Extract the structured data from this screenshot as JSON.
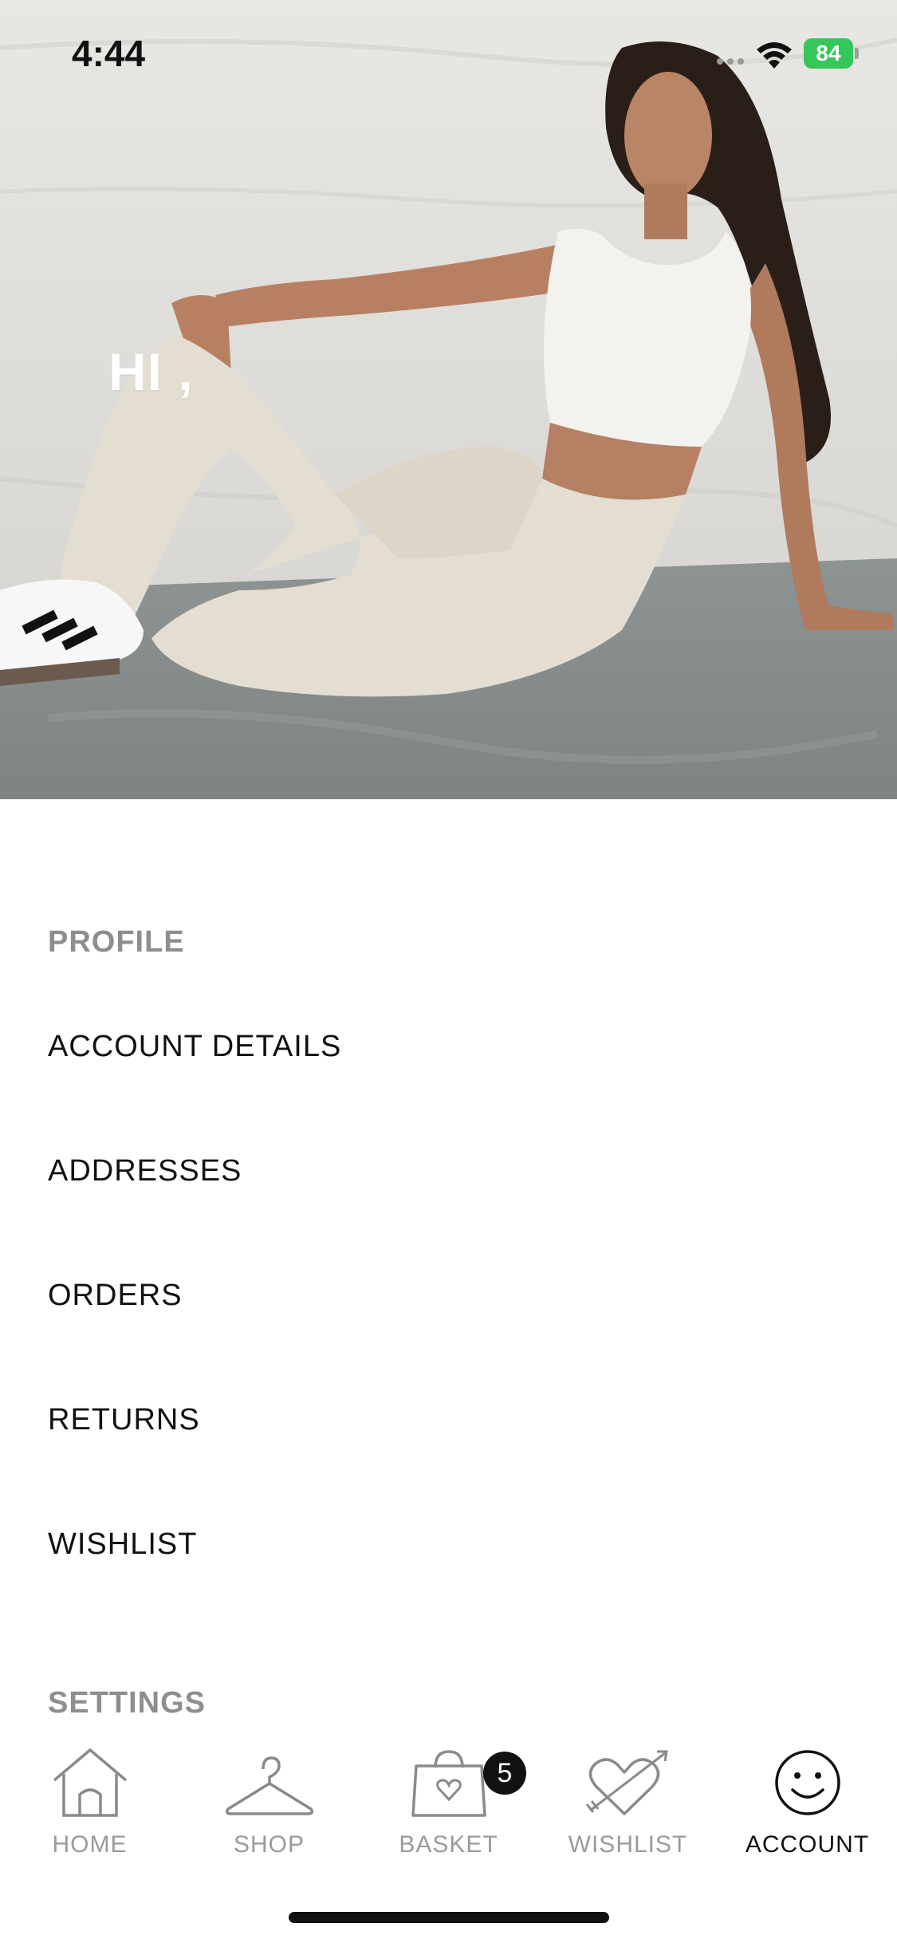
{
  "status_bar": {
    "time": "4:44",
    "battery": "84"
  },
  "hero": {
    "greeting": "HI ,"
  },
  "menu": {
    "profile_heading": "PROFILE",
    "items": [
      {
        "label": "ACCOUNT DETAILS"
      },
      {
        "label": "ADDRESSES"
      },
      {
        "label": "ORDERS"
      },
      {
        "label": "RETURNS"
      },
      {
        "label": "WISHLIST"
      }
    ],
    "settings_heading": "SETTINGS"
  },
  "tab_bar": {
    "tabs": [
      {
        "label": "HOME",
        "icon": "house-icon"
      },
      {
        "label": "SHOP",
        "icon": "hanger-icon"
      },
      {
        "label": "BASKET",
        "icon": "bag-heart-icon"
      },
      {
        "label": "WISHLIST",
        "icon": "heart-arrow-icon"
      },
      {
        "label": "ACCOUNT",
        "icon": "smiley-icon"
      }
    ],
    "active": "ACCOUNT",
    "basket_count": "5"
  },
  "colors": {
    "text_primary": "#111111",
    "text_muted": "#8e8e8e",
    "battery_green": "#35c759",
    "badge": "#111111"
  }
}
